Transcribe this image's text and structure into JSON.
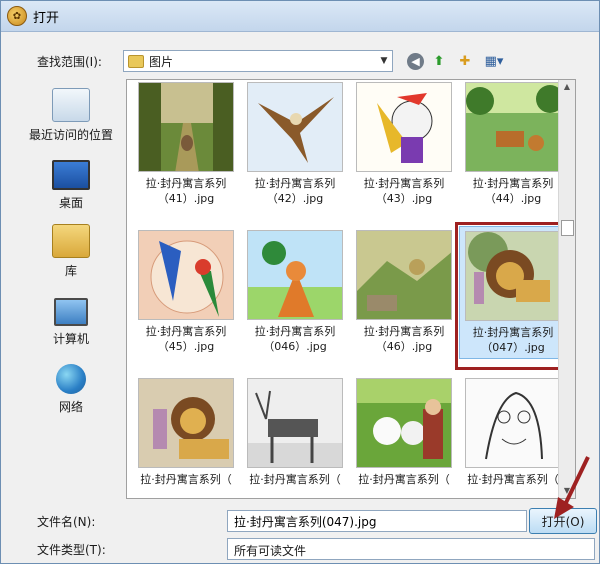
{
  "window": {
    "title": "打开"
  },
  "lookin": {
    "label": "查找范围(I):",
    "value": "图片"
  },
  "places": [
    {
      "label": "最近访问的位置",
      "icon": "recent-places-icon"
    },
    {
      "label": "桌面",
      "icon": "desktop-icon"
    },
    {
      "label": "库",
      "icon": "libraries-icon"
    },
    {
      "label": "计算机",
      "icon": "computer-icon"
    },
    {
      "label": "网络",
      "icon": "network-icon"
    }
  ],
  "files": [
    {
      "name": "拉·封丹寓言系列（41）.jpg",
      "scene": "rabbit"
    },
    {
      "name": "拉·封丹寓言系列（42）.jpg",
      "scene": "eagle"
    },
    {
      "name": "拉·封丹寓言系列（43）.jpg",
      "scene": "rooster"
    },
    {
      "name": "拉·封丹寓言系列（44）.jpg",
      "scene": "forest"
    },
    {
      "name": "拉·封丹寓言系列（45）.jpg",
      "scene": "parrots"
    },
    {
      "name": "拉·封丹寓言系列（046）.jpg",
      "scene": "fox"
    },
    {
      "name": "拉·封丹寓言系列（46）.jpg",
      "scene": "landscape"
    },
    {
      "name": "拉·封丹寓言系列（047）.jpg",
      "scene": "lion",
      "selected": true
    },
    {
      "name": "拉·封丹寓言系列（",
      "scene": "lion2"
    },
    {
      "name": "拉·封丹寓言系列（",
      "scene": "deer"
    },
    {
      "name": "拉·封丹寓言系列（",
      "scene": "goats"
    },
    {
      "name": "拉·封丹寓言系列（",
      "scene": "sketch"
    }
  ],
  "filename": {
    "label": "文件名(N):",
    "value": "拉·封丹寓言系列(047).jpg"
  },
  "filetype": {
    "label": "文件类型(T):",
    "value": "所有可读文件"
  },
  "open_button": {
    "label": "打开(O)"
  },
  "colors": {
    "selection_border": "#9e2121",
    "selection_fill": "#cde6fb",
    "arrow": "#9e2121"
  }
}
